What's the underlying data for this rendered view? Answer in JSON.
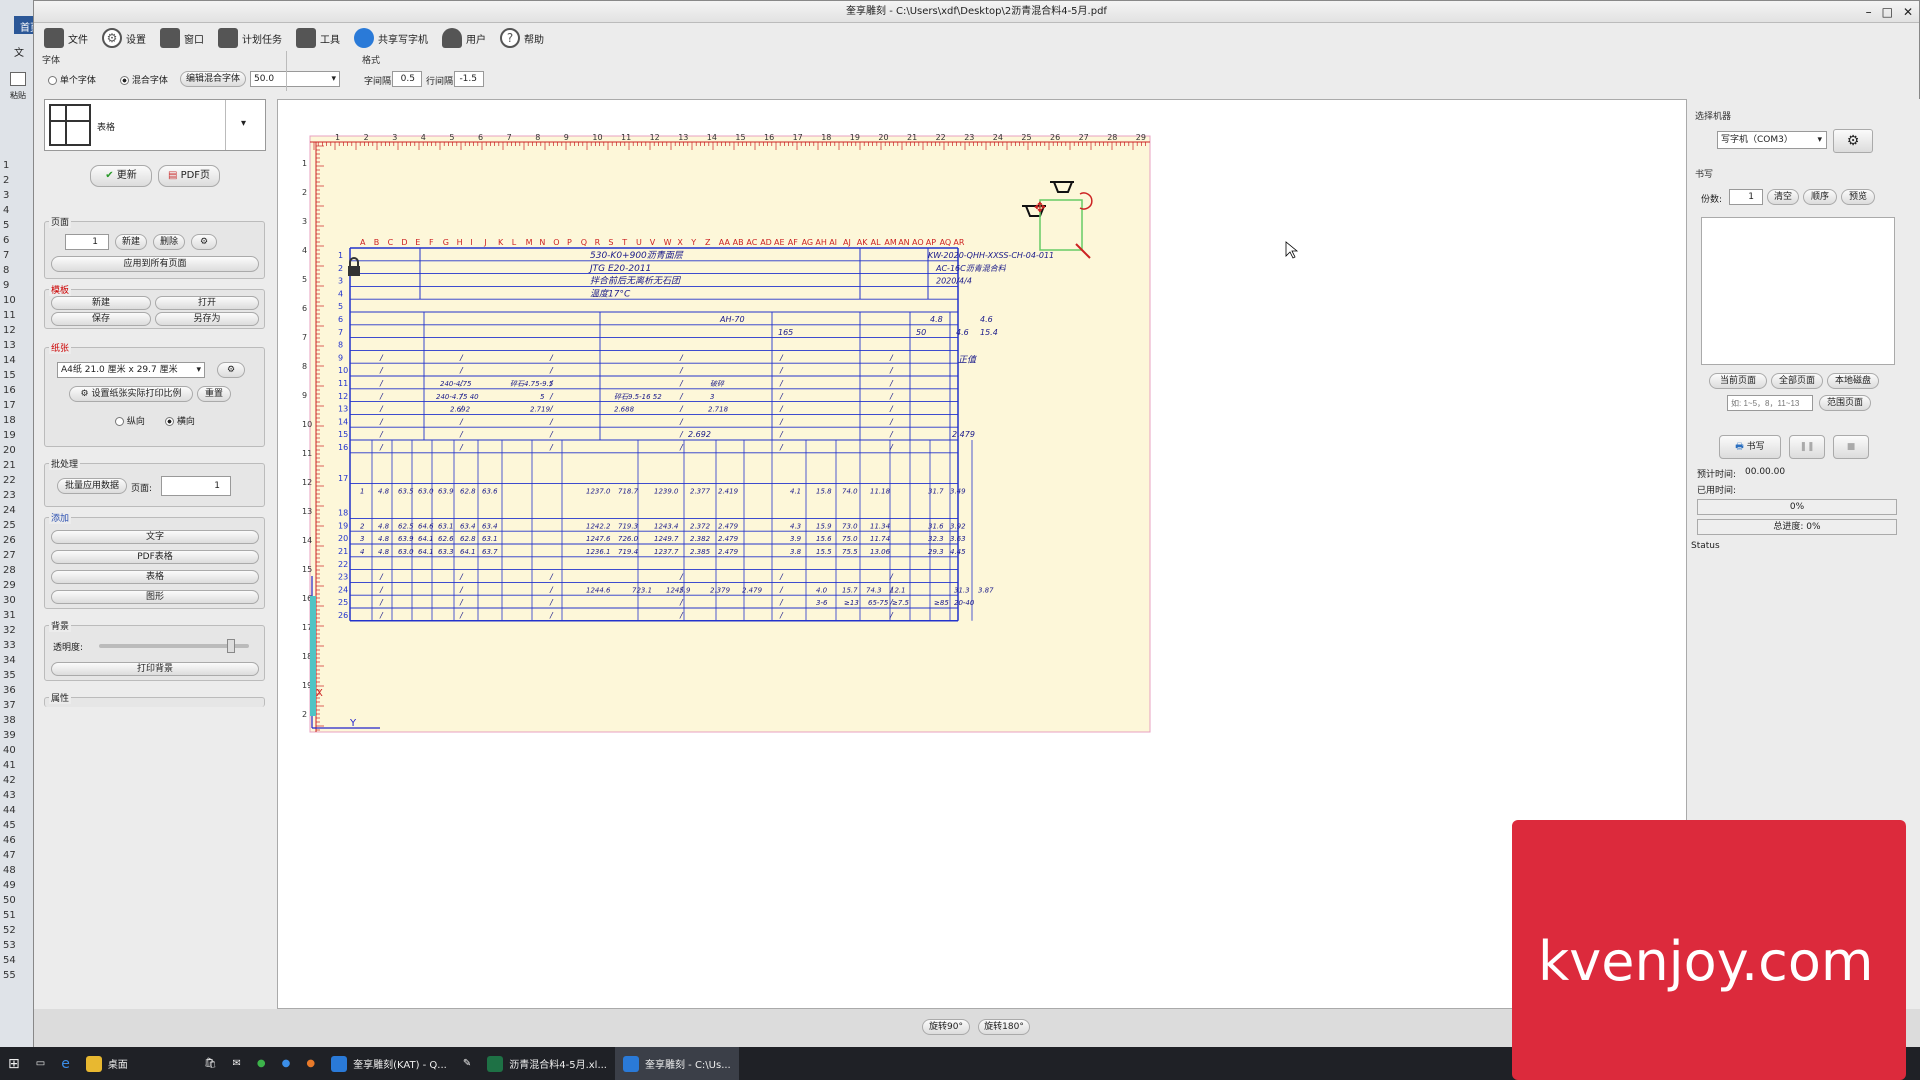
{
  "bg_app": {
    "home_tab": "首页",
    "side_items": [
      "文",
      "粘贴"
    ],
    "row_numbers": [
      "1",
      "2",
      "3",
      "4",
      "5",
      "6",
      "7",
      "8",
      "9",
      "10",
      "11",
      "12",
      "13",
      "14",
      "15",
      "16",
      "17",
      "18",
      "19",
      "20",
      "21",
      "22",
      "23",
      "24",
      "25",
      "26",
      "27",
      "28",
      "29",
      "30",
      "31",
      "32",
      "33",
      "34",
      "35",
      "36",
      "37",
      "38",
      "39",
      "40",
      "41",
      "42",
      "43",
      "44",
      "45",
      "46",
      "47",
      "48",
      "49",
      "50",
      "51",
      "52",
      "53",
      "54",
      "55"
    ]
  },
  "window": {
    "title": "奎享雕刻 - C:\\Users\\xdf\\Desktop\\2沥青混合料4-5月.pdf"
  },
  "menu": [
    {
      "label": "文件",
      "icon": "folder-icon"
    },
    {
      "label": "设置",
      "icon": "gear-icon"
    },
    {
      "label": "窗口",
      "icon": "window-icon"
    },
    {
      "label": "计划任务",
      "icon": "task-icon"
    },
    {
      "label": "工具",
      "icon": "wrench-icon"
    },
    {
      "label": "共享写字机",
      "icon": "share-icon"
    },
    {
      "label": "用户",
      "icon": "user-icon"
    },
    {
      "label": "帮助",
      "icon": "help-icon"
    }
  ],
  "font_group": {
    "label": "字体",
    "single_font": "单个字体",
    "mixed_font": "混合字体",
    "edit_mixed": "编辑混合字体",
    "font_size": "50.0"
  },
  "format_group": {
    "label": "格式",
    "char_spacing_label": "字间隔",
    "char_spacing": "0.5",
    "line_spacing_label": "行间隔",
    "line_spacing": "-1.5"
  },
  "left": {
    "doc_type": "表格",
    "update": "更新",
    "pdf_page": "PDF页",
    "page_section": "页面",
    "page_value": "1",
    "new": "新建",
    "delete": "删除",
    "apply_all": "应用到所有页面",
    "template_section": "模板",
    "tpl_new": "新建",
    "tpl_open": "打开",
    "tpl_save": "保存",
    "tpl_save_as": "另存为",
    "paper_section": "纸张",
    "paper_size": "A4纸 21.0 厘米 x 29.7 厘米",
    "set_print_ratio": "设置纸张实际打印比例",
    "reset": "重置",
    "portrait": "纵向",
    "landscape": "横向",
    "batch_section": "批处理",
    "batch_apply": "批量应用数据",
    "page_label": "页面:",
    "batch_page": "1",
    "add_section": "添加",
    "add_text": "文字",
    "add_pdf_table": "PDF表格",
    "add_table": "表格",
    "add_shape": "图形",
    "bg_section": "背景",
    "opacity": "透明度:",
    "opacity_value": 0.9,
    "print_bg": "打印背景",
    "props_section": "属性"
  },
  "document": {
    "ruler_top": [
      "1",
      "2",
      "3",
      "4",
      "5",
      "6",
      "7",
      "8",
      "9",
      "10",
      "11",
      "12",
      "13",
      "14",
      "15",
      "16",
      "17",
      "18",
      "19",
      "20",
      "21",
      "22",
      "23",
      "24",
      "25",
      "26",
      "27",
      "28",
      "29"
    ],
    "ruler_left": [
      "1",
      "2",
      "3",
      "4",
      "5",
      "6",
      "7",
      "8",
      "9",
      "10",
      "11",
      "12",
      "13",
      "14",
      "15",
      "16",
      "17",
      "18",
      "19",
      "2"
    ],
    "columns": [
      "A",
      "B",
      "C",
      "D",
      "E",
      "F",
      "G",
      "H",
      "I",
      "J",
      "K",
      "L",
      "M",
      "N",
      "O",
      "P",
      "Q",
      "R",
      "S",
      "T",
      "U",
      "V",
      "W",
      "X",
      "Y",
      "Z",
      "AA",
      "AB",
      "AC",
      "AD",
      "AE",
      "AF",
      "AG",
      "AH",
      "AI",
      "AJ",
      "AK",
      "AL",
      "AM",
      "AN",
      "AO",
      "AP",
      "AQ",
      "AR"
    ],
    "rows": [
      "1",
      "2",
      "3",
      "4",
      "5",
      "6",
      "7",
      "8",
      "9",
      "10",
      "11",
      "12",
      "13",
      "14",
      "15",
      "16",
      "17",
      "18",
      "19",
      "20",
      "21",
      "22",
      "23",
      "24",
      "25",
      "26"
    ],
    "header_lines": [
      "530-K0+900沥青面层",
      "JTG E20-2011",
      "拌合前后无离析无石团",
      "温度17°C"
    ],
    "right_lines": [
      "KW-2020-QHH-XXSS-CH-04-011",
      "AC-16C沥青混合料",
      "2020/4/4"
    ],
    "mid_texts": [
      "AH-70",
      "4.8",
      "4.6",
      "165",
      "50",
      "4.6",
      "15.4",
      "正值"
    ],
    "cells_r11": [
      "240-4.75",
      "碎石4.75-9.5",
      "破碎",
      "240-4.75  40",
      "5",
      "碎石9.5-16  52",
      "3",
      "2.692",
      "2.719",
      "2.688",
      "2.718"
    ],
    "r15": [
      "2.692",
      "2.479"
    ],
    "r18": [
      "1",
      "4.8",
      "63.5",
      "63.0",
      "63.9",
      "62.8",
      "63.6",
      "1237.0",
      "718.7",
      "1239.0",
      "2.377",
      "2.419",
      "4.1",
      "15.8",
      "74.0",
      "11.18",
      "31.7",
      "3.49"
    ],
    "r19": [
      "2",
      "4.8",
      "62.5",
      "64.6",
      "63.1",
      "63.4",
      "63.4",
      "1242.2",
      "719.3",
      "1243.4",
      "2.372",
      "2.479",
      "4.3",
      "15.9",
      "73.0",
      "11.34",
      "31.6",
      "3.92"
    ],
    "r20": [
      "3",
      "4.8",
      "63.9",
      "64.1",
      "62.6",
      "62.8",
      "63.1",
      "1247.6",
      "726.0",
      "1249.7",
      "2.382",
      "2.479",
      "3.9",
      "15.6",
      "75.0",
      "11.74",
      "32.3",
      "3.63"
    ],
    "r21": [
      "4",
      "4.8",
      "63.0",
      "64.1",
      "63.3",
      "64.1",
      "63.7",
      "1236.1",
      "719.4",
      "1237.7",
      "2.385",
      "2.479",
      "3.8",
      "15.5",
      "75.5",
      "13.06",
      "29.3",
      "4.45"
    ],
    "r24": [
      "1244.6",
      "723.1",
      "1245.9",
      "2.379",
      "2.479",
      "4.0",
      "15.7",
      "74.3",
      "12.1",
      "31.3",
      "3.87"
    ],
    "r25": [
      "3-6",
      "≥13",
      "65-75",
      "≥7.5",
      "≥85",
      "20-40"
    ]
  },
  "right": {
    "machine_section": "选择机器",
    "machine": "写字机（COM3）",
    "write_section": "书写",
    "copies_label": "份数:",
    "copies": "1",
    "clear": "清空",
    "order": "顺序",
    "preview": "预览",
    "current_page": "当前页面",
    "all_pages": "全部页面",
    "local_disk": "本地磁盘",
    "range_placeholder": "如: 1~5，8，11~13",
    "range_page": "范围页面",
    "write": "书写",
    "est_time_label": "预计时间:",
    "est_time": "00.00.00",
    "used_time_label": "已用时间:",
    "progress": "0%",
    "progress_value": 0,
    "total_progress": "总进度: 0%",
    "total_value": 0,
    "status": "Status"
  },
  "bottom": {
    "rotate90": "旋转90°",
    "rotate180": "旋转180°"
  },
  "taskbar": {
    "items": [
      {
        "label": "桌面",
        "color": "#e8b830"
      },
      {
        "label": "奎享雕刻(KAT) - Q...",
        "color": "#2a7ad8"
      },
      {
        "label": "沥青混合料4-5月.xl...",
        "color": "#1e7145"
      },
      {
        "label": "奎享雕刻 - C:\\Us...",
        "color": "#2a7ad8"
      }
    ]
  },
  "watermark": "kvenjoy.com"
}
